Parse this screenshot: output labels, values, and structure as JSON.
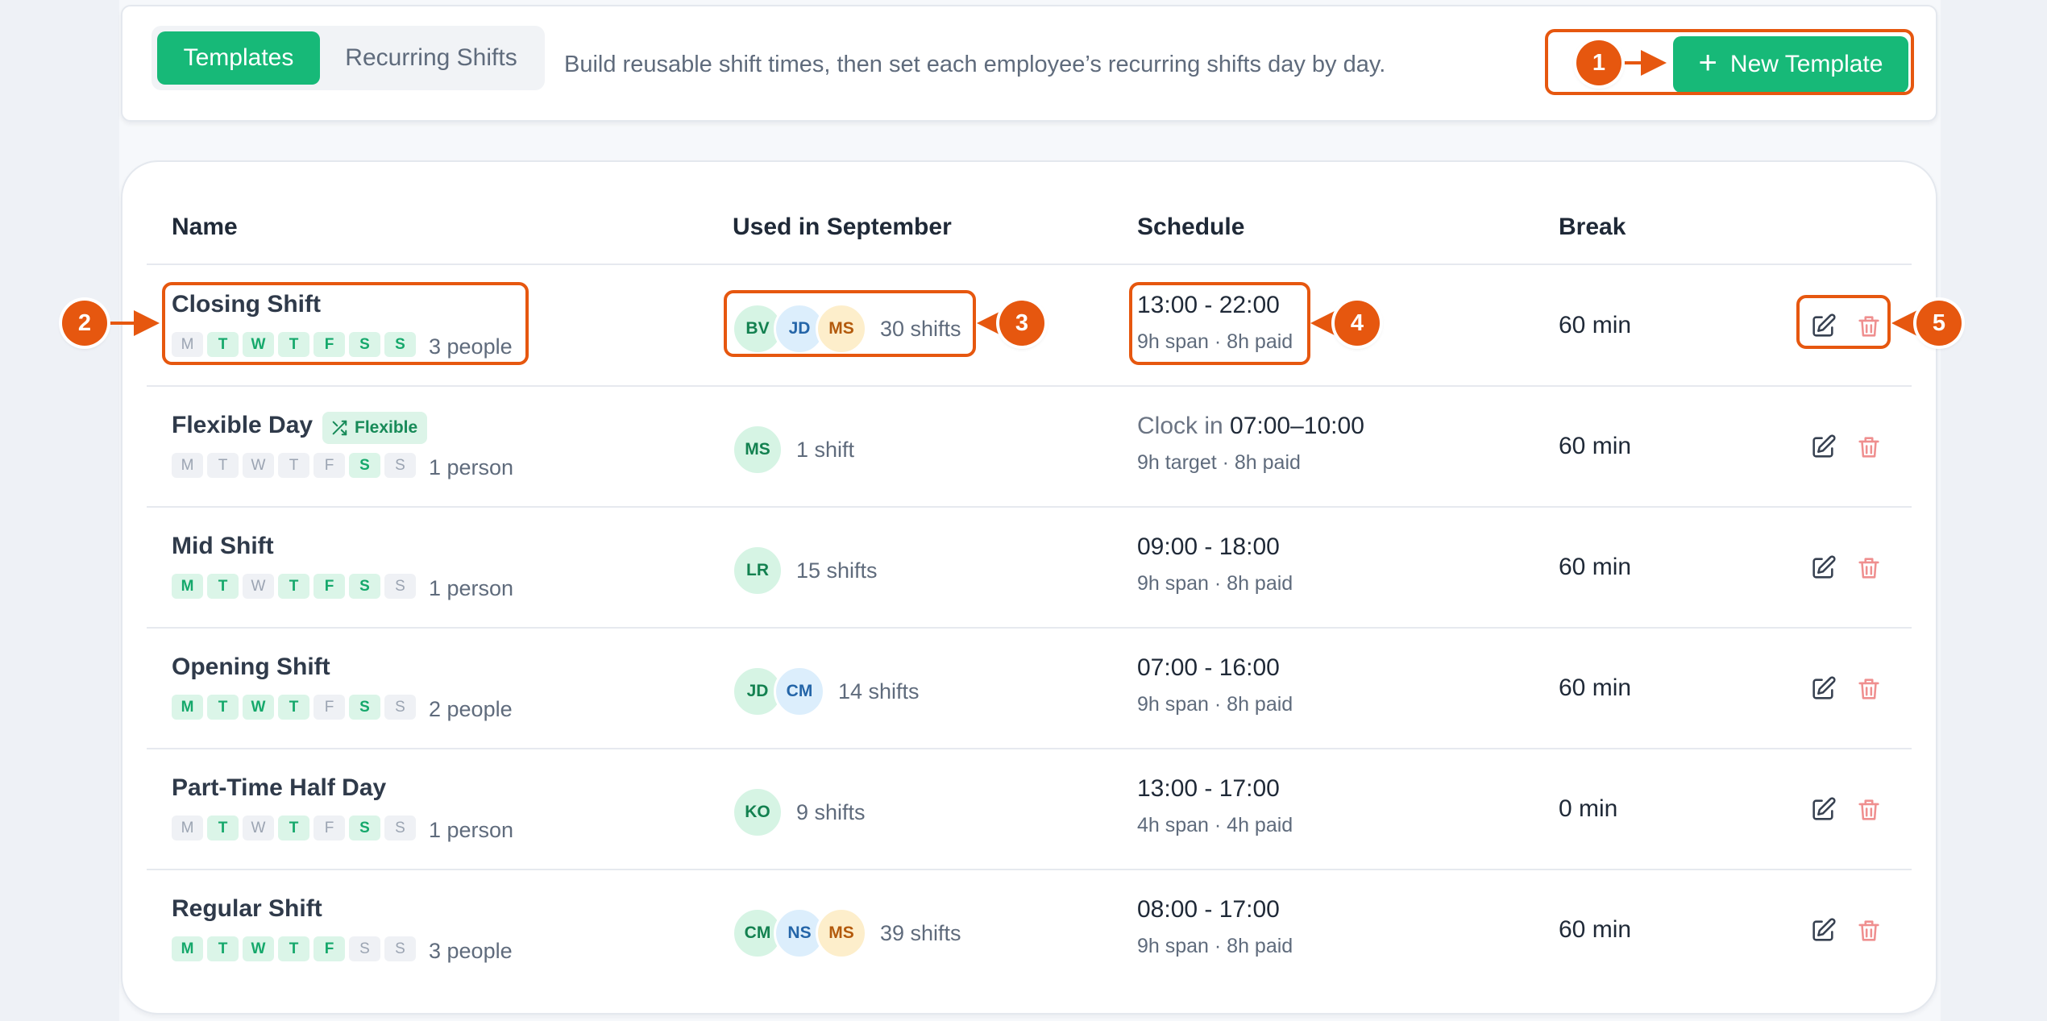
{
  "tabs": [
    {
      "label": "Templates",
      "active": true
    },
    {
      "label": "Recurring Shifts",
      "active": false
    }
  ],
  "description": "Build reusable shift times, then set each employee’s recurring shifts day by day.",
  "new_template_label": "New Template",
  "columns": {
    "name": "Name",
    "used": "Used in September",
    "schedule": "Schedule",
    "break": "Break"
  },
  "day_letters": [
    "M",
    "T",
    "W",
    "T",
    "F",
    "S",
    "S"
  ],
  "rows": [
    {
      "name": "Closing Shift",
      "days_active": [
        false,
        true,
        true,
        true,
        true,
        true,
        true
      ],
      "people": "3 people",
      "avatars": [
        {
          "initials": "BV",
          "color": "green"
        },
        {
          "initials": "JD",
          "color": "blue"
        },
        {
          "initials": "MS",
          "color": "yellow"
        }
      ],
      "shifts": "30 shifts",
      "schedule_prefix": "",
      "schedule": "13:00 - 22:00",
      "schedule_sub": "9h span · 8h paid",
      "break": "60 min"
    },
    {
      "name": "Flexible Day",
      "badge": "Flexible",
      "days_active": [
        false,
        false,
        false,
        false,
        false,
        true,
        false
      ],
      "people": "1 person",
      "avatars": [
        {
          "initials": "MS",
          "color": "green"
        }
      ],
      "shifts": "1 shift",
      "schedule_prefix": "Clock in",
      "schedule": "07:00–10:00",
      "schedule_sub": "9h target · 8h paid",
      "break": "60 min"
    },
    {
      "name": "Mid Shift",
      "days_active": [
        true,
        true,
        false,
        true,
        true,
        true,
        false
      ],
      "people": "1 person",
      "avatars": [
        {
          "initials": "LR",
          "color": "green"
        }
      ],
      "shifts": "15 shifts",
      "schedule_prefix": "",
      "schedule": "09:00 - 18:00",
      "schedule_sub": "9h span · 8h paid",
      "break": "60 min"
    },
    {
      "name": "Opening Shift",
      "days_active": [
        true,
        true,
        true,
        true,
        false,
        true,
        false
      ],
      "people": "2 people",
      "avatars": [
        {
          "initials": "JD",
          "color": "green"
        },
        {
          "initials": "CM",
          "color": "blue"
        }
      ],
      "shifts": "14 shifts",
      "schedule_prefix": "",
      "schedule": "07:00 - 16:00",
      "schedule_sub": "9h span · 8h paid",
      "break": "60 min"
    },
    {
      "name": "Part-Time Half Day",
      "days_active": [
        false,
        true,
        false,
        true,
        false,
        true,
        false
      ],
      "people": "1 person",
      "avatars": [
        {
          "initials": "KO",
          "color": "green"
        }
      ],
      "shifts": "9 shifts",
      "schedule_prefix": "",
      "schedule": "13:00 - 17:00",
      "schedule_sub": "4h span · 4h paid",
      "break": "0 min"
    },
    {
      "name": "Regular Shift",
      "days_active": [
        true,
        true,
        true,
        true,
        true,
        false,
        false
      ],
      "people": "3 people",
      "avatars": [
        {
          "initials": "CM",
          "color": "green"
        },
        {
          "initials": "NS",
          "color": "blue"
        },
        {
          "initials": "MS",
          "color": "yellow"
        }
      ],
      "shifts": "39 shifts",
      "schedule_prefix": "",
      "schedule": "08:00 - 17:00",
      "schedule_sub": "9h span · 8h paid",
      "break": "60 min"
    }
  ],
  "callouts": [
    "1",
    "2",
    "3",
    "4",
    "5"
  ],
  "colors": {
    "accent": "#17b978",
    "callout": "#e6570f",
    "delete_icon": "#ef8f8f"
  }
}
